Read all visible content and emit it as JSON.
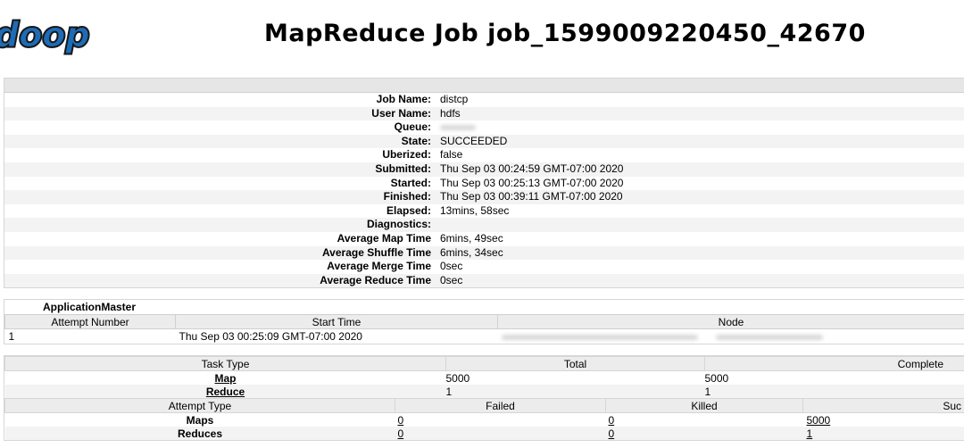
{
  "brand": {
    "logo_text": "doop"
  },
  "page": {
    "title": "MapReduce Job job_1599009220450_42670"
  },
  "job_info": {
    "rows": [
      {
        "label": "Job Name:",
        "value": "distcp"
      },
      {
        "label": "User Name:",
        "value": "hdfs"
      },
      {
        "label": "Queue:",
        "value": ""
      },
      {
        "label": "State:",
        "value": "SUCCEEDED"
      },
      {
        "label": "Uberized:",
        "value": "false"
      },
      {
        "label": "Submitted:",
        "value": "Thu Sep 03 00:24:59 GMT-07:00 2020"
      },
      {
        "label": "Started:",
        "value": "Thu Sep 03 00:25:13 GMT-07:00 2020"
      },
      {
        "label": "Finished:",
        "value": "Thu Sep 03 00:39:11 GMT-07:00 2020"
      },
      {
        "label": "Elapsed:",
        "value": "13mins, 58sec"
      },
      {
        "label": "Diagnostics:",
        "value": ""
      },
      {
        "label": "Average Map Time",
        "value": "6mins, 49sec"
      },
      {
        "label": "Average Shuffle Time",
        "value": "6mins, 34sec"
      },
      {
        "label": "Average Merge Time",
        "value": "0sec"
      },
      {
        "label": "Average Reduce Time",
        "value": "0sec"
      }
    ]
  },
  "application_master": {
    "caption": "ApplicationMaster",
    "headers": {
      "attempt": "Attempt Number",
      "start": "Start Time",
      "node": "Node"
    },
    "row": {
      "attempt": "1",
      "start": "Thu Sep 03 00:25:09 GMT-07:00 2020",
      "node": ""
    }
  },
  "task_summary": {
    "headers": {
      "type": "Task Type",
      "total": "Total",
      "complete": "Complete"
    },
    "rows": [
      {
        "type": "Map",
        "total": "5000",
        "complete": "5000"
      },
      {
        "type": "Reduce",
        "total": "1",
        "complete": "1"
      }
    ]
  },
  "attempt_summary": {
    "headers": {
      "type": "Attempt Type",
      "failed": "Failed",
      "killed": "Killed",
      "successful": "Suc"
    },
    "rows": [
      {
        "type": "Maps",
        "failed": "0",
        "killed": "0",
        "successful": "5000"
      },
      {
        "type": "Reduces",
        "failed": "0",
        "killed": "0",
        "successful": "1"
      }
    ]
  },
  "colors": {
    "header_bg": "#ececec",
    "stripe_bg": "#f3f3f3",
    "logo_blue": "#1f6bb5"
  }
}
